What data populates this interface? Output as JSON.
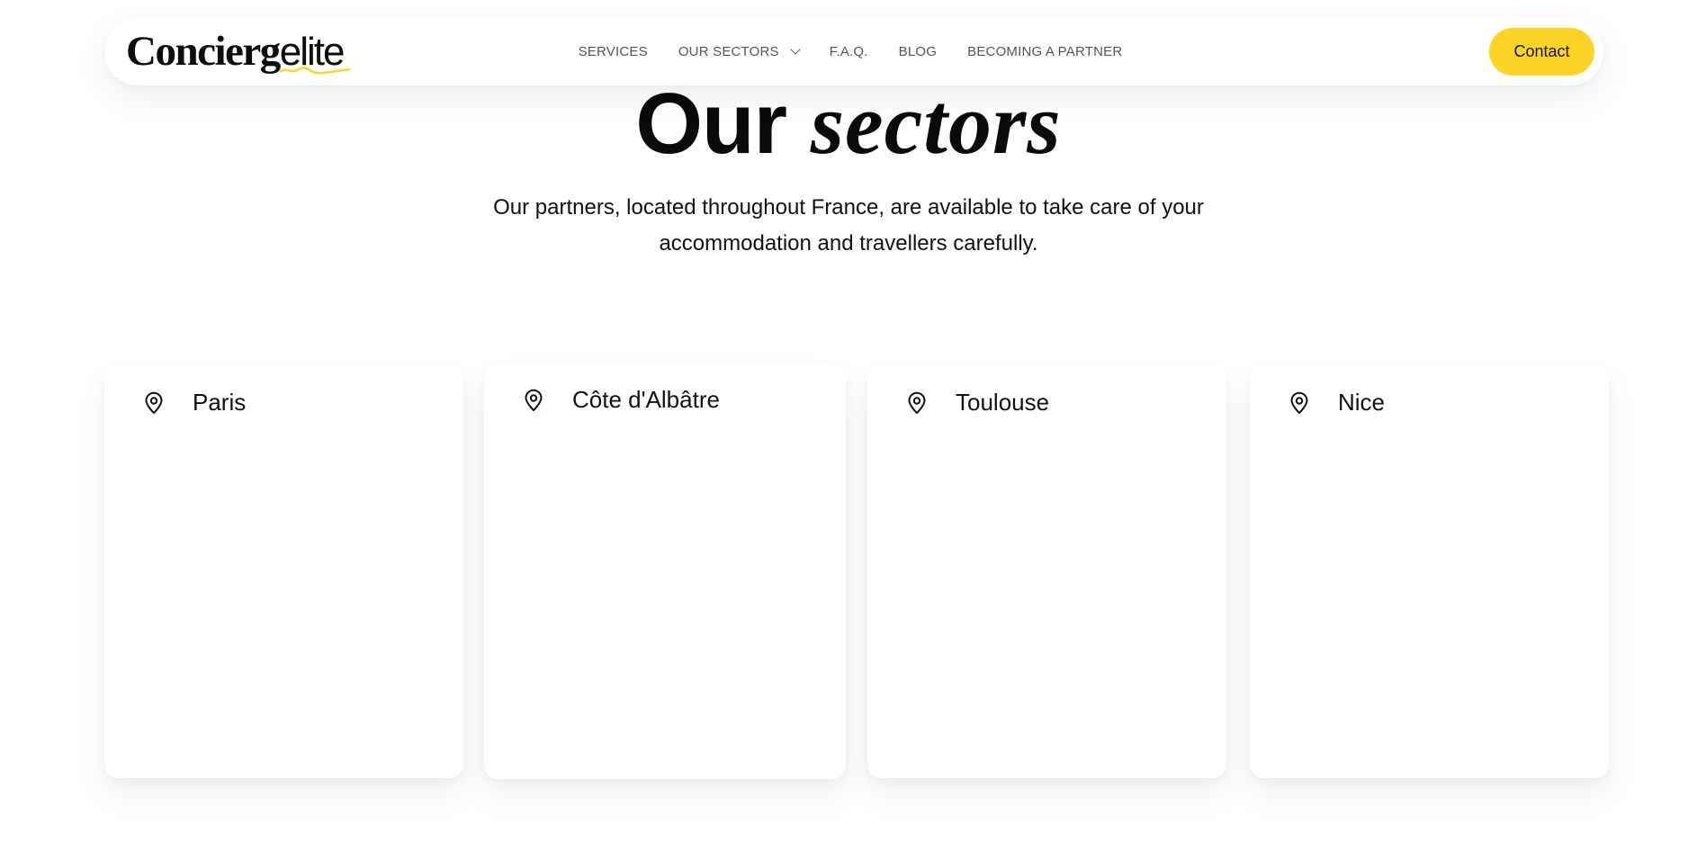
{
  "header": {
    "logo": {
      "bold": "Concierg",
      "light": "elite"
    },
    "nav": [
      {
        "label": "SERVICES"
      },
      {
        "label": "OUR SECTORS",
        "dropdown": true
      },
      {
        "label": "F.A.Q."
      },
      {
        "label": "BLOG"
      },
      {
        "label": "BECOMING A PARTNER"
      }
    ],
    "contact_label": "Contact",
    "accent_color": "#fdd425"
  },
  "hero": {
    "title_regular": "Our",
    "title_italic": "sectors",
    "subtitle_line1": "Our partners, located throughout France, are available to take care of your",
    "subtitle_line2": "accommodation and travellers carefully."
  },
  "sectors": [
    {
      "name": "Paris",
      "icon": "location-pin-icon"
    },
    {
      "name": "Côte d'Albâtre",
      "icon": "location-pin-icon"
    },
    {
      "name": "Toulouse",
      "icon": "location-pin-icon"
    },
    {
      "name": "Nice",
      "icon": "location-pin-icon"
    }
  ]
}
